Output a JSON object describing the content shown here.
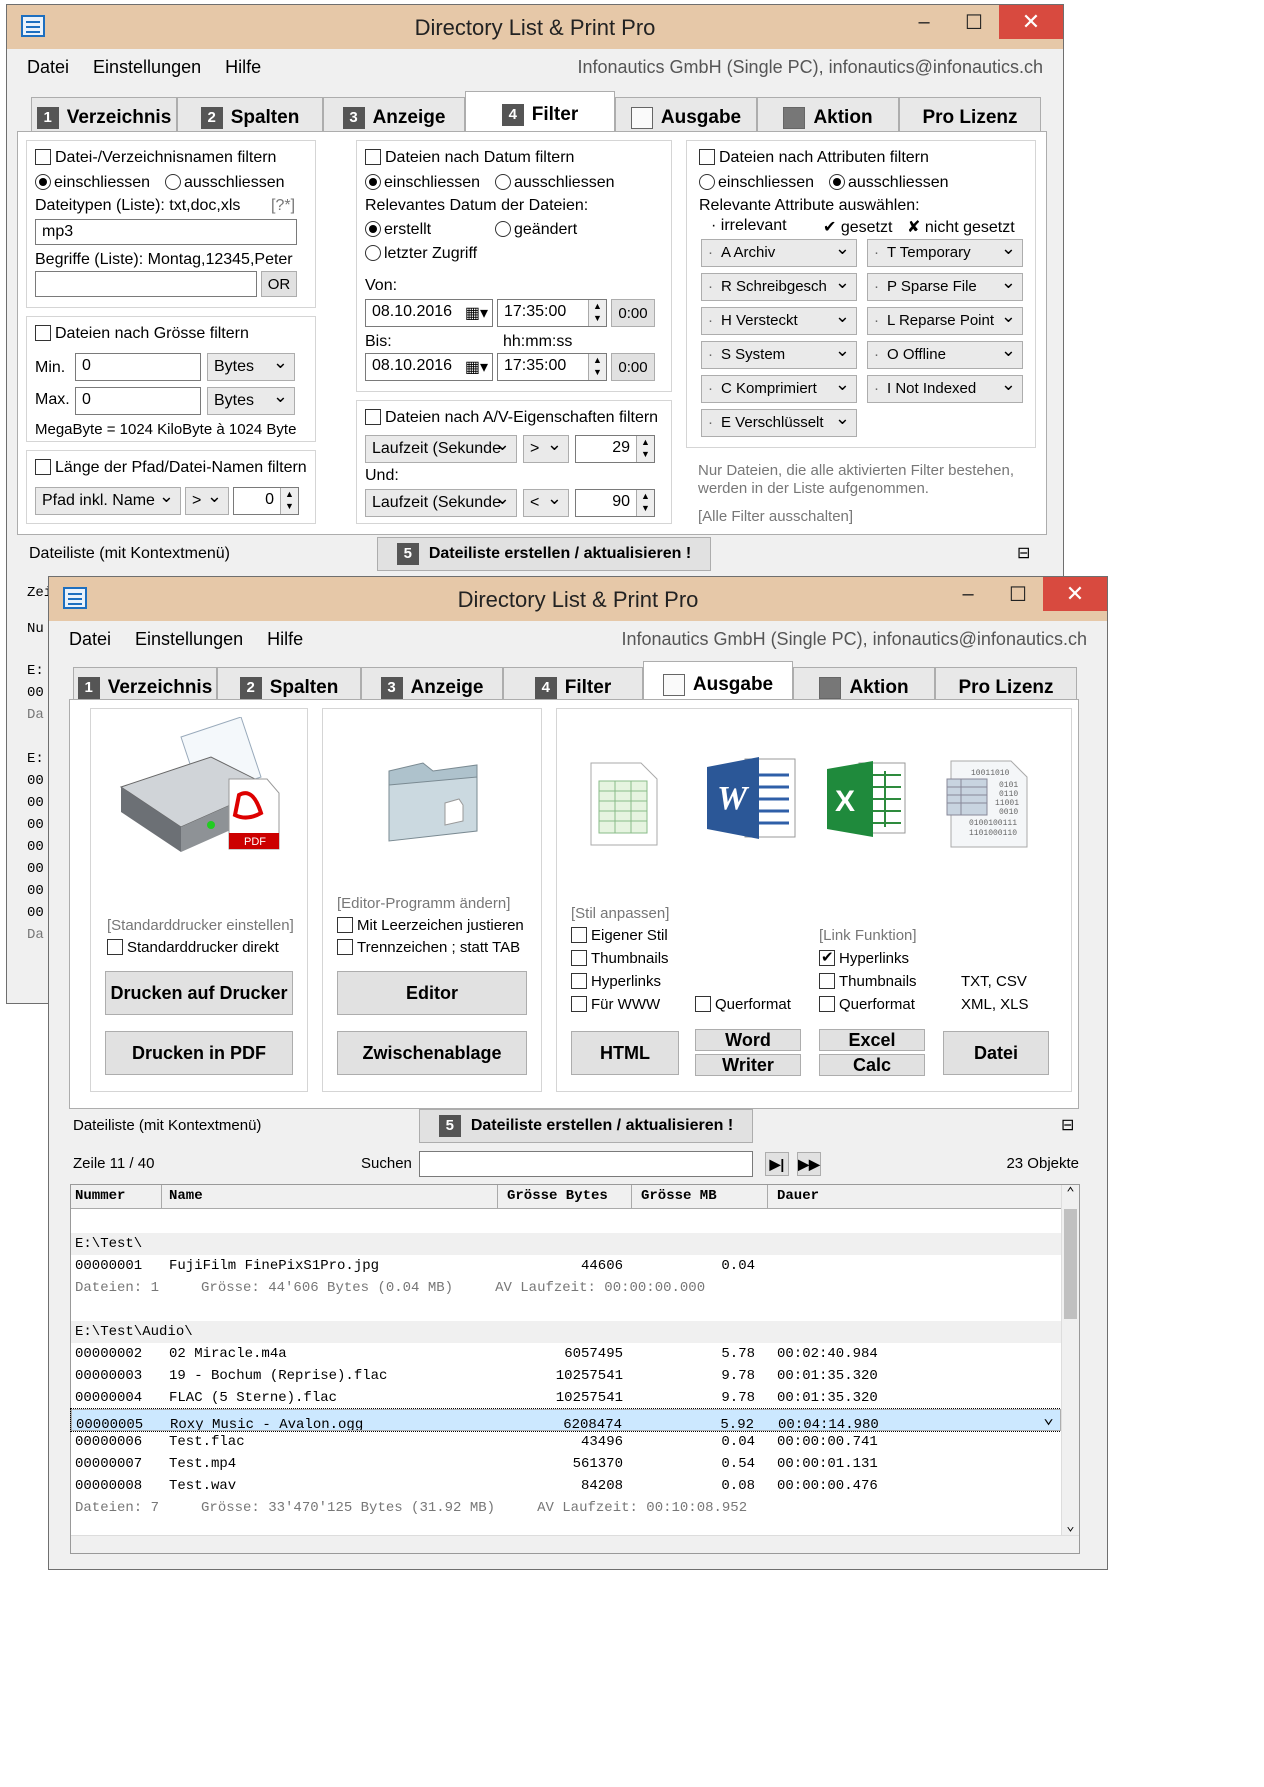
{
  "app_title": "Directory List & Print Pro",
  "menu": {
    "datei": "Datei",
    "einstellungen": "Einstellungen",
    "hilfe": "Hilfe",
    "license": "Infonautics GmbH (Single PC), infonautics@infonautics.ch"
  },
  "tabs": [
    {
      "num": "1",
      "label": "Verzeichnis"
    },
    {
      "num": "2",
      "label": "Spalten"
    },
    {
      "num": "3",
      "label": "Anzeige"
    },
    {
      "num": "4",
      "label": "Filter"
    },
    {
      "num": "",
      "label": "Ausgabe"
    },
    {
      "num": "",
      "label": "Aktion"
    },
    {
      "num": "",
      "label": "Pro Lizenz"
    }
  ],
  "filter": {
    "name_filter": "Datei-/Verzeichnisnamen filtern",
    "include": "einschliessen",
    "exclude": "ausschliessen",
    "types_label": "Dateitypen (Liste): txt,doc,xls",
    "types_help": "[?*]",
    "types_value": "mp3",
    "terms_label": "Begriffe (Liste): Montag,12345,Peter",
    "or_btn": "OR",
    "size_filter": "Dateien nach Grösse filtern",
    "min_label": "Min.",
    "max_label": "Max.",
    "min_value": "0",
    "max_value": "0",
    "unit": "Bytes",
    "mb_note": "MegaByte = 1024 KiloByte à 1024 Byte",
    "path_filter": "Länge der Pfad/Datei-Namen filtern",
    "path_select": "Pfad inkl. Name",
    "path_op": ">",
    "path_value": "0",
    "date_filter": "Dateien nach Datum filtern",
    "relevant_date": "Relevantes Datum der Dateien:",
    "created": "erstellt",
    "changed": "geändert",
    "last_access": "letzter Zugriff",
    "from_label": "Von:",
    "to_label": "Bis:",
    "time_hint": "hh:mm:ss",
    "date_value": "08.10.2016",
    "time_value": "17:35:00",
    "reset_time": "0:00",
    "av_filter": "Dateien nach A/V-Eigenschaften filtern",
    "av_select": "Laufzeit (Sekunde",
    "av_op1": ">",
    "av_val1": "29",
    "and_label": "Und:",
    "av_op2": "<",
    "av_val2": "90",
    "attr_filter": "Dateien nach Attributen filtern",
    "attr_relevant": "Relevante Attribute auswählen:",
    "legend_irrelevant": "irrelevant",
    "legend_set": "gesetzt",
    "legend_notset": "nicht gesetzt",
    "attrs_left": [
      "A Archiv",
      "R Schreibgesch",
      "H Versteckt",
      "S System",
      "C Komprimiert",
      "E Verschlüsselt"
    ],
    "attrs_right": [
      "T Temporary",
      "P Sparse File",
      "L Reparse Point",
      "O Offline",
      "I  Not Indexed"
    ],
    "note": "Nur Dateien, die alle aktivierten Filter bestehen, werden in der Liste aufgenommen.",
    "disable_all": "[Alle Filter ausschalten]"
  },
  "filelist_label": "Dateiliste (mit Kontextmenü)",
  "create_btn_num": "5",
  "create_btn": "Dateiliste erstellen / aktualisieren !",
  "back_snips": [
    "Zei",
    "Nu",
    "E:",
    "00",
    "Da",
    "E:",
    "00",
    "00",
    "00",
    "00",
    "00",
    "00",
    "00",
    "Da"
  ],
  "output": {
    "printer_link": "[Standarddrucker einstellen]",
    "printer_direct": "Standarddrucker direkt",
    "print_btn": "Drucken auf Drucker",
    "pdf_btn": "Drucken in PDF",
    "editor_link": "[Editor-Programm ändern]",
    "pad_spaces": "Mit Leerzeichen justieren",
    "tab_sep": "Trennzeichen ; statt TAB",
    "editor_btn": "Editor",
    "clipboard_btn": "Zwischenablage",
    "style_link": "[Stil anpassen]",
    "own_style": "Eigener Stil",
    "thumbnails": "Thumbnails",
    "hyperlinks": "Hyperlinks",
    "for_www": "Für WWW",
    "landscape": "Querformat",
    "link_function": "[Link Funktion]",
    "hyperlinks2": "Hyperlinks",
    "thumbnails2": "Thumbnails",
    "landscape2": "Querformat",
    "txt_csv": "TXT, CSV",
    "xml_xls": "XML, XLS",
    "html_btn": "HTML",
    "word_btn": "Word",
    "writer_btn": "Writer",
    "excel_btn": "Excel",
    "calc_btn": "Calc",
    "file_btn": "Datei",
    "pdf_badge": "PDF",
    "w_badge": "W",
    "x_badge": "X",
    "bin_lines": [
      "10011010",
      "0101",
      "0110",
      "11001",
      "0010",
      "0100100111",
      "1101000110"
    ]
  },
  "status": {
    "line": "Zeile 11 / 40",
    "search_label": "Suchen",
    "search_value": "",
    "count": "23 Objekte"
  },
  "table": {
    "columns": [
      "Nummer",
      "Name",
      "Grösse Bytes",
      "Grösse MB",
      "Dauer"
    ],
    "rows": [
      {
        "type": "blank"
      },
      {
        "type": "hd",
        "text": "E:\\Test\\"
      },
      {
        "type": "data",
        "nr": "00000001",
        "name": "FujiFilm FinePixS1Pro.jpg",
        "bytes": "44606",
        "mb": "0.04",
        "dur": ""
      },
      {
        "type": "sum",
        "text": "Dateien: 1     Grösse: 44'606 Bytes (0.04 MB)     AV Laufzeit: 00:00:00.000"
      },
      {
        "type": "blank"
      },
      {
        "type": "hd",
        "text": "E:\\Test\\Audio\\"
      },
      {
        "type": "data",
        "nr": "00000002",
        "name": "02 Miracle.m4a",
        "bytes": "6057495",
        "mb": "5.78",
        "dur": "00:02:40.984"
      },
      {
        "type": "data",
        "nr": "00000003",
        "name": "19 - Bochum (Reprise).flac",
        "bytes": "10257541",
        "mb": "9.78",
        "dur": "00:01:35.320"
      },
      {
        "type": "data",
        "nr": "00000004",
        "name": "FLAC (5 Sterne).flac",
        "bytes": "10257541",
        "mb": "9.78",
        "dur": "00:01:35.320"
      },
      {
        "type": "data",
        "sel": true,
        "nr": "00000005",
        "name": "Roxy Music - Avalon.ogg",
        "bytes": "6208474",
        "mb": "5.92",
        "dur": "00:04:14.980"
      },
      {
        "type": "data",
        "nr": "00000006",
        "name": "Test.flac",
        "bytes": "43496",
        "mb": "0.04",
        "dur": "00:00:00.741"
      },
      {
        "type": "data",
        "nr": "00000007",
        "name": "Test.mp4",
        "bytes": "561370",
        "mb": "0.54",
        "dur": "00:00:01.131"
      },
      {
        "type": "data",
        "nr": "00000008",
        "name": "Test.wav",
        "bytes": "84208",
        "mb": "0.08",
        "dur": "00:00:00.476"
      },
      {
        "type": "sum",
        "text": "Dateien: 7     Grösse: 33'470'125 Bytes (31.92 MB)     AV Laufzeit: 00:10:08.952"
      }
    ]
  }
}
